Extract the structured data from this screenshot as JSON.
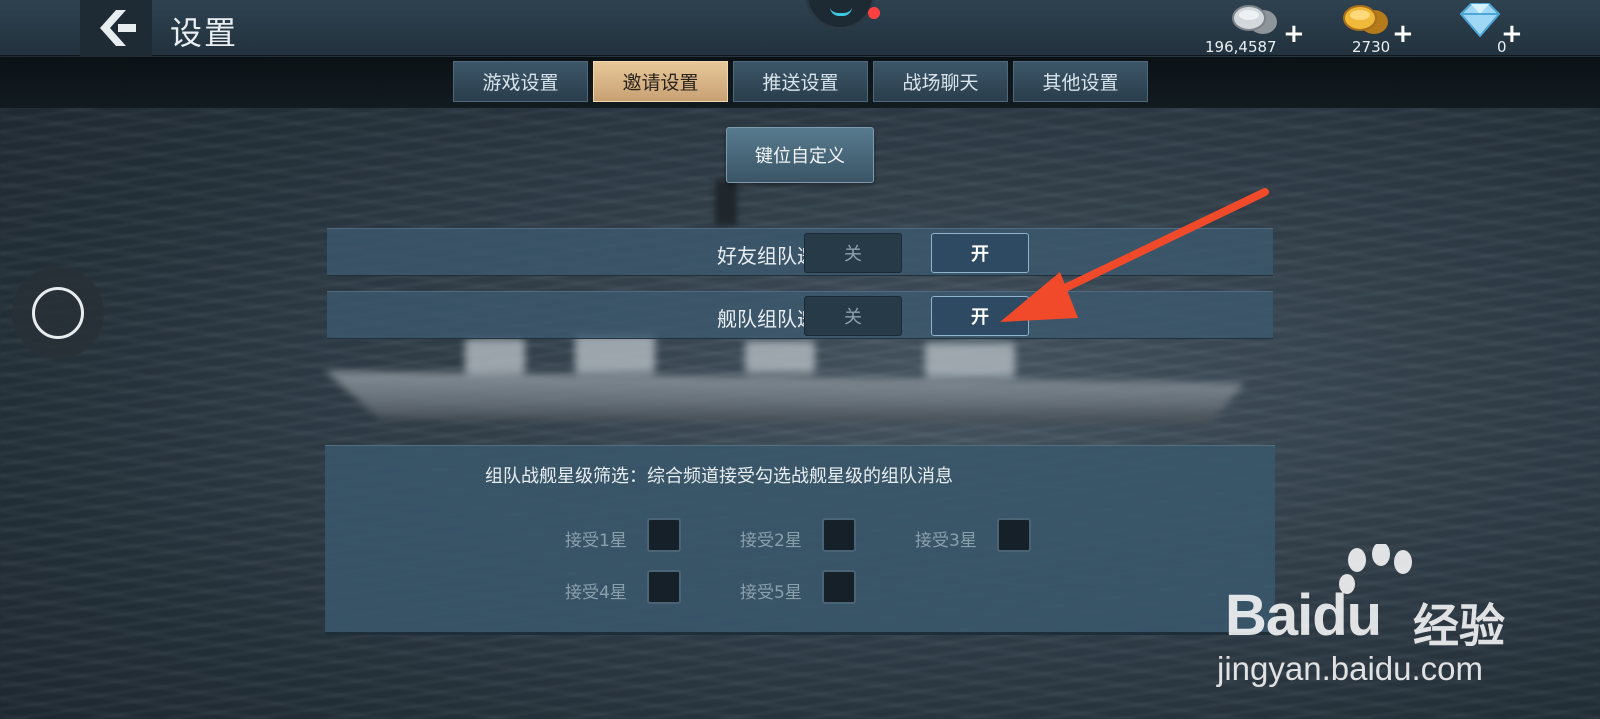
{
  "header": {
    "title": "设置",
    "currencies": [
      {
        "name": "silver-coins",
        "value": "196,4587",
        "plus": "+"
      },
      {
        "name": "gold-coins",
        "value": "2730",
        "plus": "+"
      },
      {
        "name": "diamonds",
        "value": "0",
        "plus": "+"
      }
    ]
  },
  "tabs": [
    {
      "label": "游戏设置",
      "active": false
    },
    {
      "label": "邀请设置",
      "active": true
    },
    {
      "label": "推送设置",
      "active": false
    },
    {
      "label": "战场聊天",
      "active": false
    },
    {
      "label": "其他设置",
      "active": false
    }
  ],
  "key_custom_button": "键位自定义",
  "settings": [
    {
      "label": "好友组队邀请",
      "off": "关",
      "on": "开",
      "state": "on"
    },
    {
      "label": "舰队组队邀请",
      "off": "关",
      "on": "开",
      "state": "on"
    }
  ],
  "star_filter": {
    "title": "组队战舰星级筛选：综合频道接受勾选战舰星级的组队消息",
    "options": [
      {
        "label": "接受1星",
        "checked": false
      },
      {
        "label": "接受2星",
        "checked": false
      },
      {
        "label": "接受3星",
        "checked": false
      },
      {
        "label": "接受4星",
        "checked": false
      },
      {
        "label": "接受5星",
        "checked": false
      }
    ]
  },
  "watermark": {
    "brand": "Baidu",
    "cn": "经验",
    "url": "jingyan.baidu.com"
  },
  "colors": {
    "active_tab": "#d9b585",
    "annotation_arrow": "#f04a2a"
  }
}
